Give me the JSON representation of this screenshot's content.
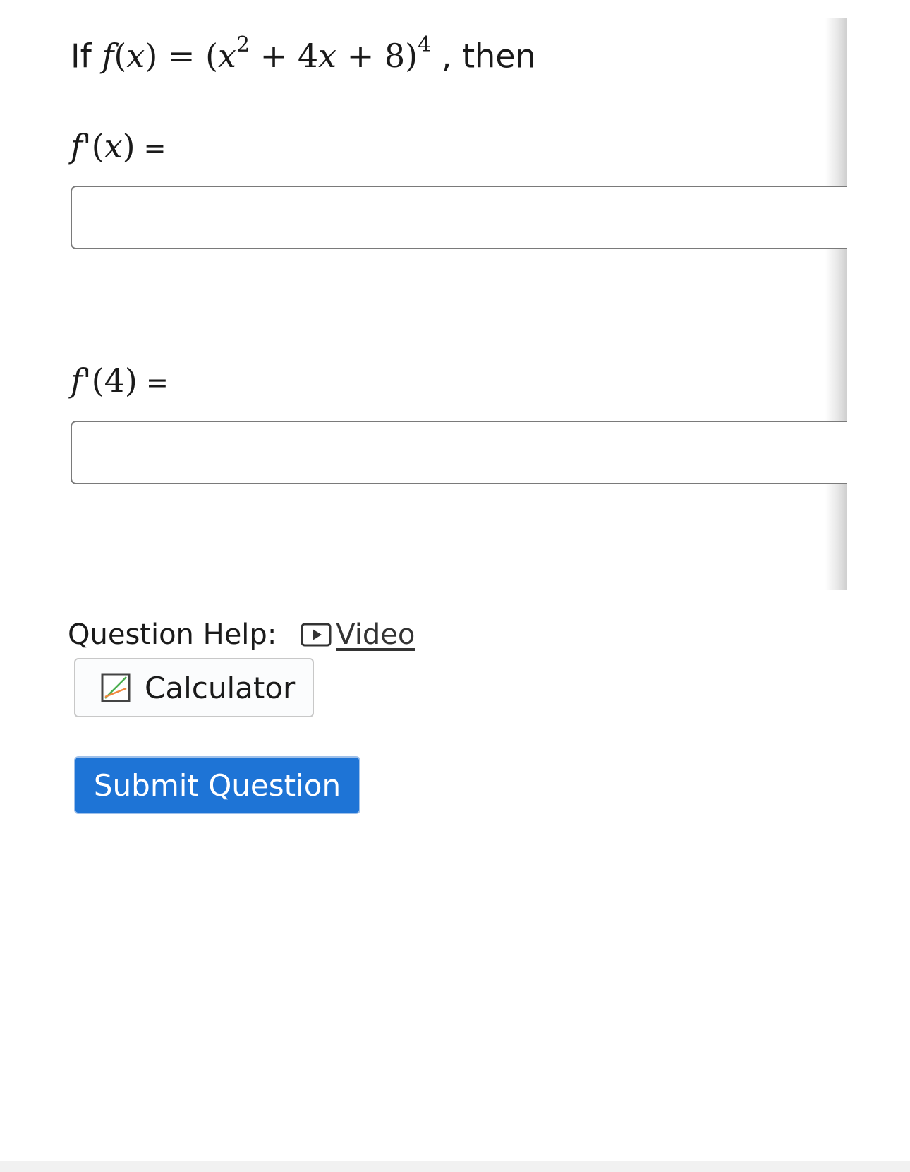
{
  "question": {
    "lead": "If",
    "func_name": "f",
    "var": "x",
    "equals": "=",
    "base_x": "x",
    "exp2": "2",
    "mid": " + 4",
    "mid_var": "x",
    "end": " + 8",
    "outer_exp": "4",
    "tail": ", then"
  },
  "part1": {
    "func": "f",
    "prime": "'",
    "arg_var": "x",
    "eq": " =",
    "value": ""
  },
  "part2": {
    "func": "f",
    "prime": "'",
    "arg": "4",
    "eq": " =",
    "value": ""
  },
  "help": {
    "label": "Question Help:",
    "video_label": "Video",
    "video_icon": "video-play-icon"
  },
  "calculator": {
    "label": "Calculator",
    "icon": "graph-calculator-icon"
  },
  "submit": {
    "label": "Submit Question",
    "color": "#1e74d6"
  }
}
